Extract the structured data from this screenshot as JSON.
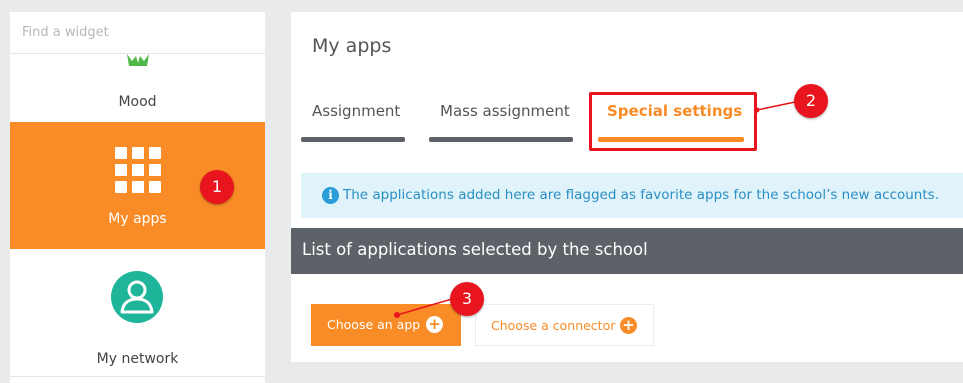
{
  "sidebar": {
    "search_placeholder": "Find a widget",
    "items": [
      {
        "label": "Mood",
        "icon": "mood-icon"
      },
      {
        "label": "My apps",
        "icon": "apps-grid-icon",
        "active": true
      },
      {
        "label": "My network",
        "icon": "user-circle-icon"
      }
    ]
  },
  "main": {
    "title": "My apps",
    "tabs": [
      {
        "label": "Assignment"
      },
      {
        "label": "Mass assignment"
      },
      {
        "label": "Special settings",
        "active": true
      }
    ],
    "info_icon": "info-icon",
    "info_text": "The applications added here are flagged as favorite apps for the school’s new accounts.",
    "section_title": "List of applications selected by the school",
    "buttons": {
      "choose_app": "Choose an app",
      "choose_connector": "Choose a connector"
    }
  },
  "annotations": [
    "1",
    "2",
    "3"
  ],
  "colors": {
    "accent": "#f98c26",
    "annotation": "#e8141e",
    "dark_bar": "#5d6269",
    "info_bg": "#e0f3fa",
    "info_text": "#2a8fc4",
    "network_icon": "#1fb59a"
  }
}
